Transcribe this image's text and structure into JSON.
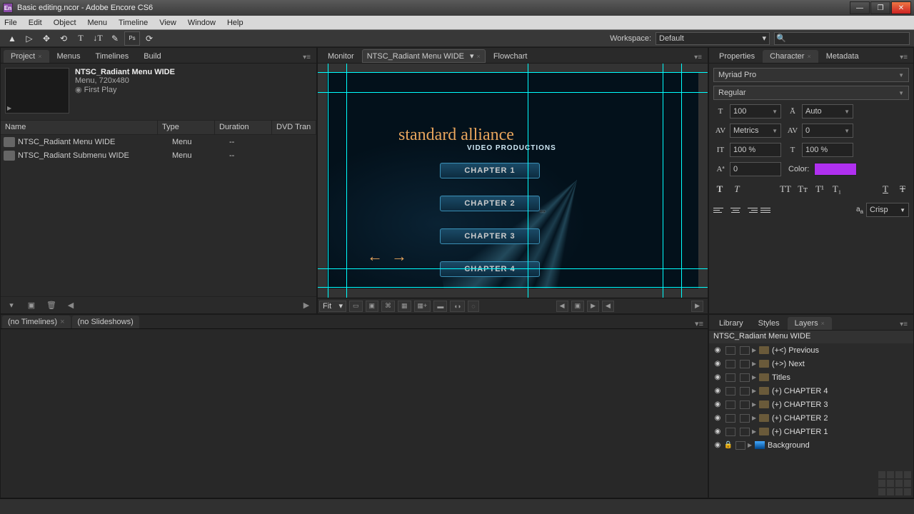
{
  "window": {
    "title": "Basic editing.ncor - Adobe Encore CS6"
  },
  "menubar": [
    "File",
    "Edit",
    "Object",
    "Menu",
    "Timeline",
    "View",
    "Window",
    "Help"
  ],
  "workspace": {
    "label": "Workspace:",
    "value": "Default"
  },
  "panels": {
    "left_tabs": [
      "Project",
      "Menus",
      "Timelines",
      "Build"
    ],
    "left_active": 0,
    "mid_tabs": {
      "monitor": "Monitor",
      "dropdown": "NTSC_Radiant Menu WIDE",
      "flow": "Flowchart"
    },
    "right_tabs": [
      "Properties",
      "Character",
      "Metadata"
    ],
    "right_active": 1
  },
  "project": {
    "name": "NTSC_Radiant Menu WIDE",
    "meta": "Menu, 720x480",
    "first": "First Play",
    "columns": [
      "Name",
      "Type",
      "Duration",
      "DVD Tran"
    ],
    "rows": [
      {
        "name": "NTSC_Radiant Menu WIDE",
        "type": "Menu",
        "dur": "--",
        "dvd": "--"
      },
      {
        "name": "NTSC_Radiant Submenu WIDE",
        "type": "Menu",
        "dur": "--",
        "dvd": "--"
      }
    ]
  },
  "monitor": {
    "zoom": "Fit",
    "title1": "standard alliance",
    "title2": "VIDEO PRODUCTIONS",
    "chapters": [
      "CHAPTER 1",
      "CHAPTER 2",
      "CHAPTER 3",
      "CHAPTER 4"
    ]
  },
  "character": {
    "font": "Myriad Pro",
    "style": "Regular",
    "size": "100",
    "leading": "Auto",
    "kerning": "Metrics",
    "tracking": "0",
    "vscale": "100 %",
    "hscale": "100 %",
    "baseline": "0",
    "color_label": "Color:",
    "color": "#b030f0",
    "aa": "Crisp"
  },
  "timelines": {
    "tab1": "(no Timelines)",
    "tab2": "(no Slideshows)"
  },
  "layers_panel": {
    "tabs": [
      "Library",
      "Styles",
      "Layers"
    ],
    "active": 2,
    "title": "NTSC_Radiant Menu WIDE",
    "layers": [
      {
        "name": "(+<) Previous",
        "folder": true,
        "eye": true
      },
      {
        "name": "(+>) Next",
        "folder": true,
        "eye": true
      },
      {
        "name": "Titles",
        "folder": true,
        "eye": true
      },
      {
        "name": "(+) CHAPTER 4",
        "folder": true,
        "eye": true
      },
      {
        "name": "(+) CHAPTER 3",
        "folder": true,
        "eye": true
      },
      {
        "name": "(+) CHAPTER 2",
        "folder": true,
        "eye": true
      },
      {
        "name": "(+) CHAPTER 1",
        "folder": true,
        "eye": true
      },
      {
        "name": "Background",
        "folder": false,
        "eye": true,
        "lock": true
      }
    ]
  }
}
